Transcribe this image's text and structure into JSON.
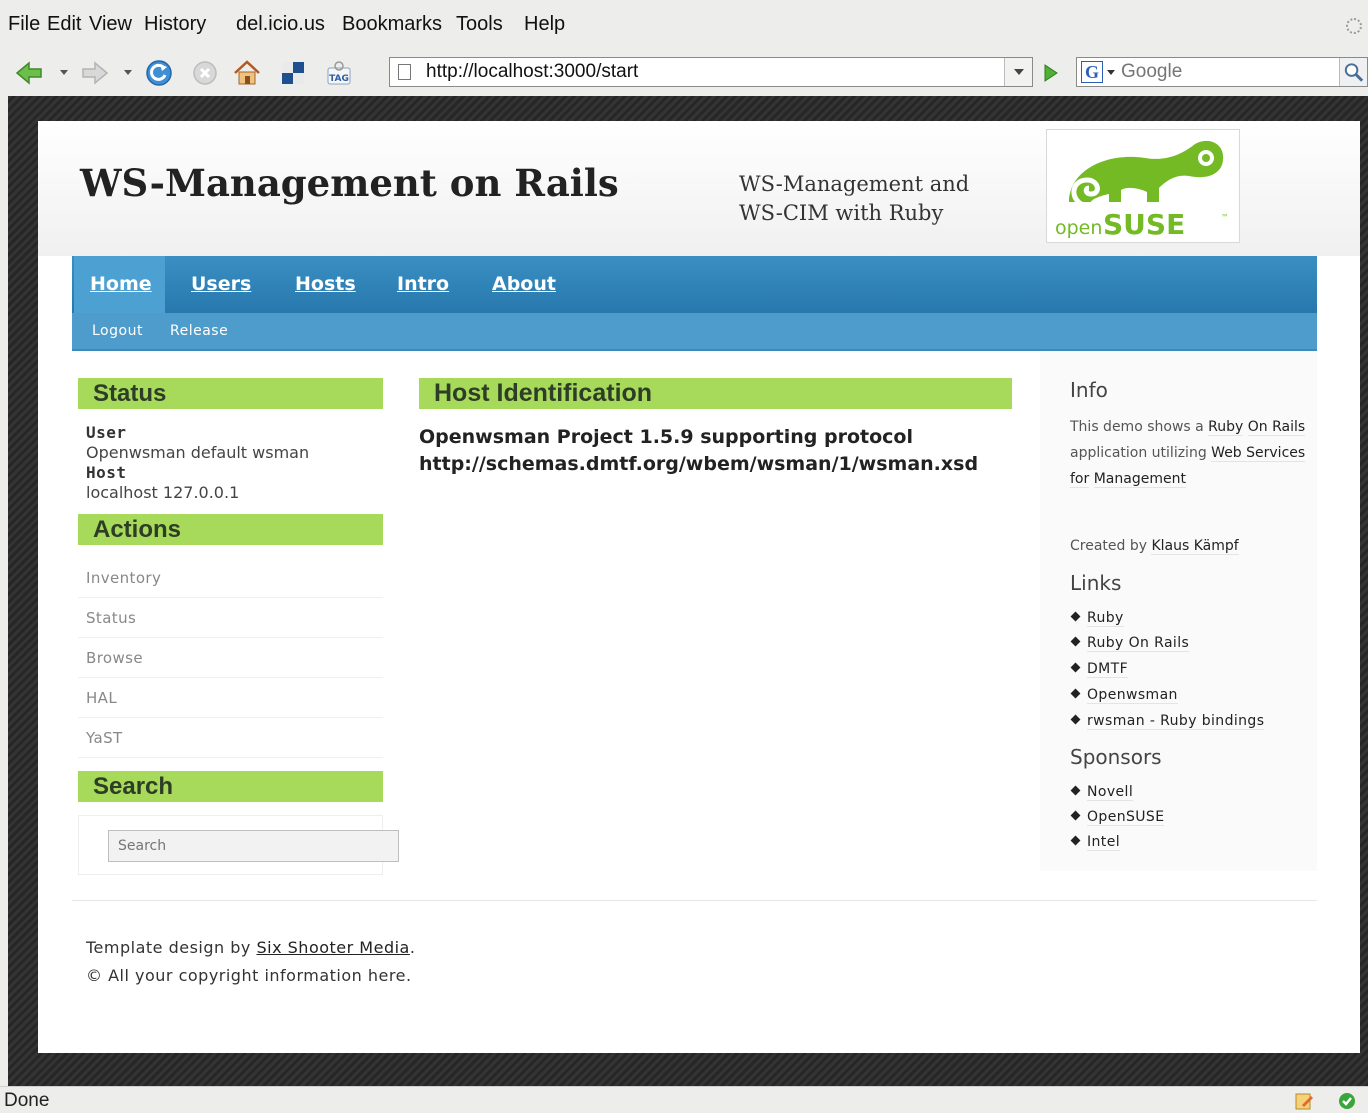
{
  "browser": {
    "menu": [
      {
        "label": "File"
      },
      {
        "label": "Edit"
      },
      {
        "label": "View"
      },
      {
        "label": "History"
      },
      {
        "label": "del.icio.us"
      },
      {
        "label": "Bookmarks"
      },
      {
        "label": "Tools"
      },
      {
        "label": "Help"
      }
    ],
    "url": "http://localhost:3000/start",
    "search_placeholder": "Google",
    "search_engine_icon": "G",
    "status": "Done",
    "icons": [
      "back-icon",
      "forward-icon",
      "reload-icon",
      "stop-icon",
      "home-icon",
      "bookmark-manager-icon",
      "tag-icon",
      "go-icon",
      "search-icon"
    ]
  },
  "site": {
    "title": "WS-Management on Rails",
    "tagline_line1": "WS-Management and",
    "tagline_line2": "WS-CIM with Ruby",
    "logo_text_open": "open",
    "logo_text_suse": "SUSE",
    "logo_tm": "™"
  },
  "nav": {
    "tabs": [
      "Home",
      "Users",
      "Hosts",
      "Intro",
      "About"
    ],
    "active": "Home",
    "subnav": [
      "Logout",
      "Release"
    ]
  },
  "status_box": {
    "heading": "Status",
    "user_label": "User",
    "user_value": "Openwsman default wsman",
    "host_label": "Host",
    "host_value": "localhost 127.0.0.1"
  },
  "actions_box": {
    "heading": "Actions",
    "items": [
      "Inventory",
      "Status",
      "Browse",
      "HAL",
      "YaST"
    ]
  },
  "search_box": {
    "heading": "Search",
    "placeholder": "Search"
  },
  "main": {
    "heading": "Host Identification",
    "line1": "Openwsman Project 1.5.9 supporting protocol",
    "line2": "http://schemas.dmtf.org/wbem/wsman/1/wsman.xsd"
  },
  "sidebar": {
    "info_heading": "Info",
    "info_prefix": "This demo shows a",
    "info_link1": "Ruby",
    "info_link1b": "On Rails",
    "info_mid": "application utilizing",
    "info_link2": "Web Services for",
    "info_link2b": "Management",
    "created_prefix": "Created by",
    "created_author": "Klaus Kämpf",
    "links_heading": "Links",
    "links": [
      "Ruby",
      "Ruby On Rails",
      "DMTF",
      "Openwsman",
      "rwsman - Ruby bindings"
    ],
    "sponsors_heading": "Sponsors",
    "sponsors": [
      "Novell",
      "OpenSUSE",
      "Intel"
    ]
  },
  "footer": {
    "credit_prefix": "Template design by",
    "credit_link": "Six Shooter Media",
    "credit_suffix": ".",
    "copyright": "© All your copyright information here."
  },
  "colors": {
    "nav_blue": "#2778ad",
    "heading_green": "#a7d95b",
    "suse_green": "#73ba25"
  }
}
